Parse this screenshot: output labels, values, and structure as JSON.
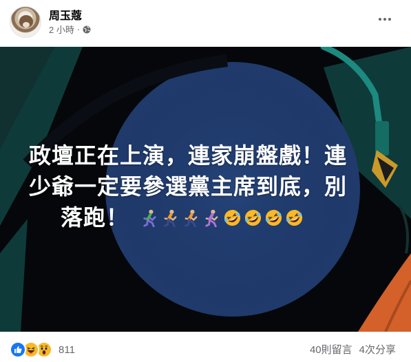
{
  "post": {
    "author": "周玉蔻",
    "time": "2 小時",
    "separator": "·",
    "privacy_icon": "globe-icon",
    "more_icon": "more-options-icon"
  },
  "media": {
    "text_lines": [
      "政壇正在上演，連家崩盤戲！連",
      "少爺一定要參選黨主席到底，別",
      "落跑！"
    ],
    "emojis": [
      "person-running-icon",
      "person-running-icon",
      "person-running-icon",
      "person-running-icon",
      "rofl-icon",
      "rofl-icon",
      "rofl-icon",
      "rofl-icon"
    ],
    "background_colors": {
      "base": "#05070a",
      "circle": "#1f3a6b",
      "teal": "#1c8a7e",
      "orange": "#d4612a",
      "dark_green": "#0f3a3a"
    }
  },
  "footer": {
    "reactions": [
      "like-icon",
      "haha-icon",
      "wow-icon"
    ],
    "reaction_count": "811",
    "comments": "40則留言",
    "shares": "4次分享"
  },
  "colors": {
    "like": "#1877f2",
    "haha": "#f7b928"
  }
}
